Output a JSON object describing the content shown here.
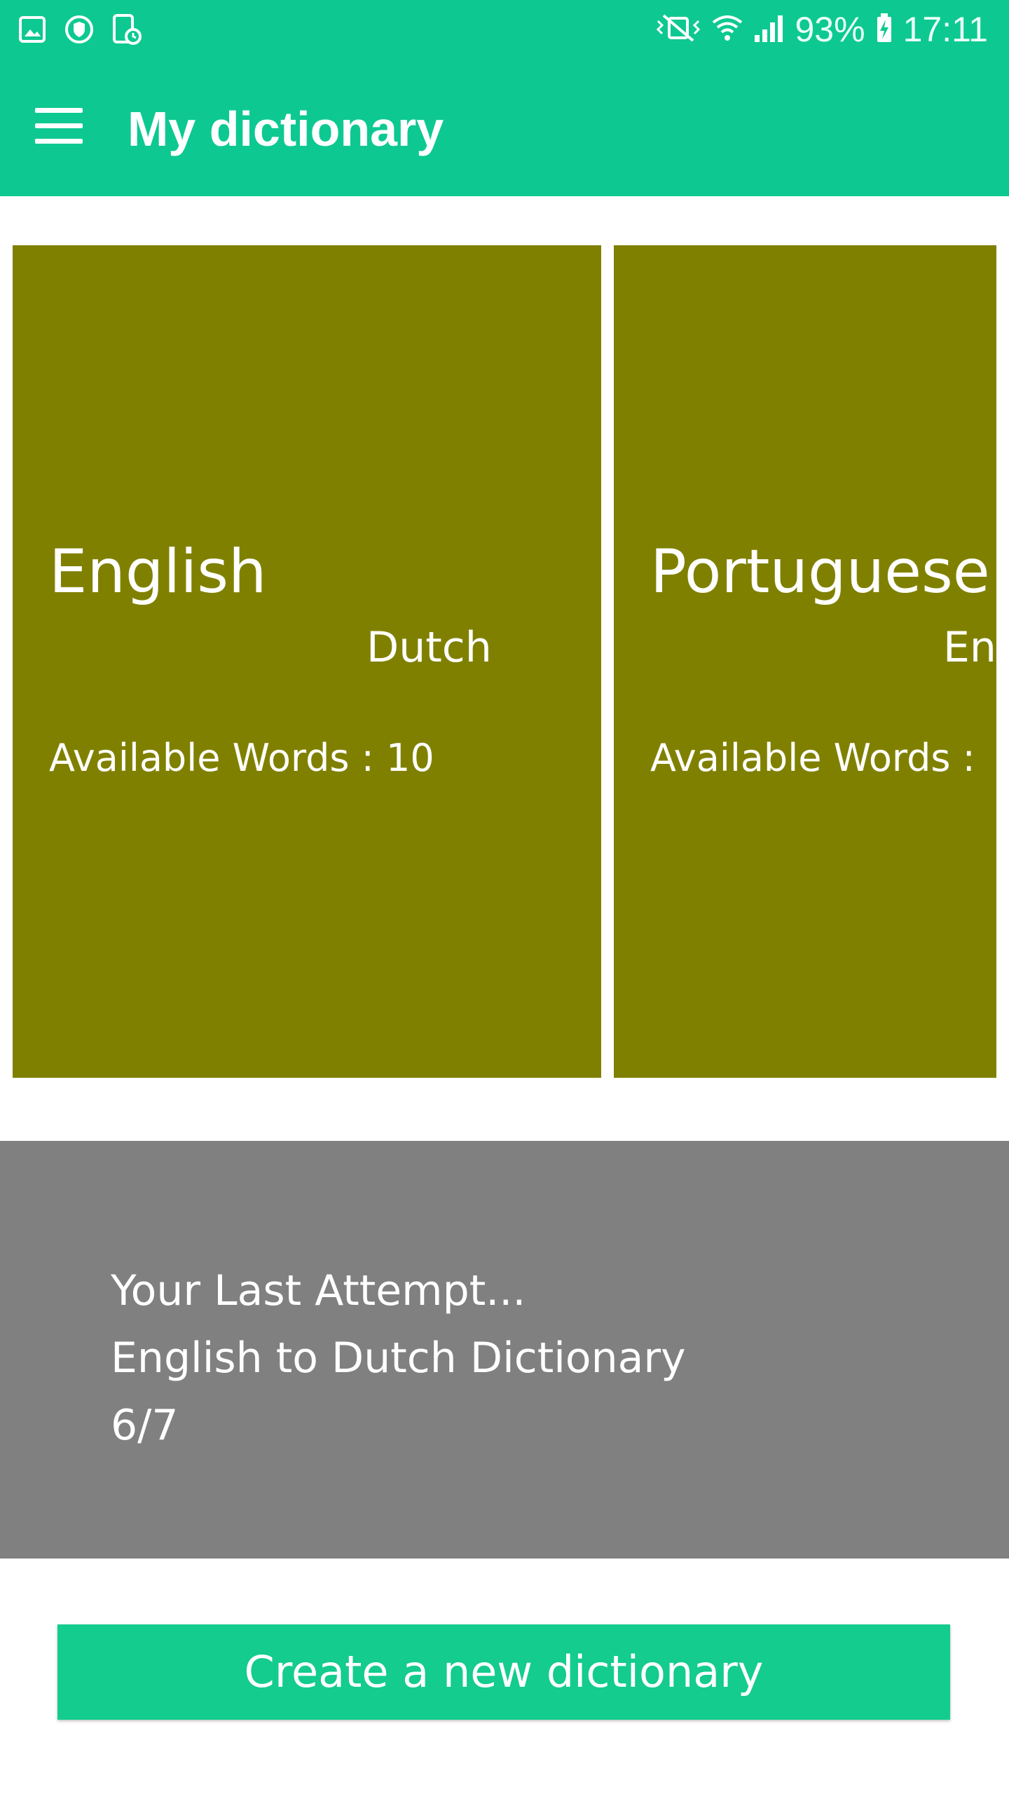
{
  "status_bar": {
    "icons_left": [
      "gallery-icon",
      "shield-icon",
      "phone-clock-icon"
    ],
    "icons_right": [
      "mute-vibrate-icon",
      "wifi-icon",
      "signal-icon"
    ],
    "battery": "93%",
    "time": "17:11"
  },
  "app_bar": {
    "menu_icon": "hamburger-menu-icon",
    "title": "My dictionary"
  },
  "colors": {
    "primary": "#0dc991",
    "card": "#808000",
    "panel": "#808080",
    "button": "#13cc8e"
  },
  "dictionaries": [
    {
      "from": "English",
      "to": "Dutch",
      "words": "Available Words : 10"
    },
    {
      "from": "Portuguese",
      "to": "En",
      "words": "Available Words :"
    }
  ],
  "last_attempt": {
    "heading": "Your Last Attempt...",
    "dictionary": "English to Dutch Dictionary",
    "score": "6/7"
  },
  "create_button": {
    "label": "Create a new dictionary"
  }
}
